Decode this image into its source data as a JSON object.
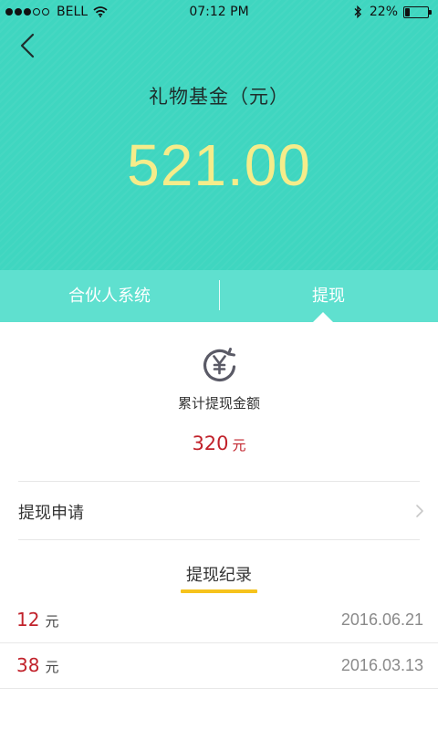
{
  "status_bar": {
    "carrier": "BELL",
    "time": "07:12 PM",
    "battery_text": "22%",
    "battery_level": 0.22,
    "icons": [
      "signal-dots-icon",
      "wifi-icon",
      "bluetooth-icon",
      "battery-icon"
    ]
  },
  "header": {
    "title": "礼物基金（元）",
    "amount": "521.00",
    "background_color": "#3fd6c0",
    "amount_color": "#f5ec8a"
  },
  "tabs": [
    {
      "label": "合伙人系统",
      "active": false
    },
    {
      "label": "提现",
      "active": true
    }
  ],
  "summary": {
    "icon": "yen-cycle-icon",
    "label": "累计提现金额",
    "value": "320",
    "unit": "元",
    "value_color": "#c1222b"
  },
  "apply": {
    "label": "提现申请",
    "icon": "chevron-right-icon"
  },
  "records": {
    "title": "提现纪录",
    "underline_color": "#f6c31c",
    "items": [
      {
        "amount": "12",
        "unit": "元",
        "date": "2016.06.21"
      },
      {
        "amount": "38",
        "unit": "元",
        "date": "2016.03.13"
      }
    ]
  }
}
